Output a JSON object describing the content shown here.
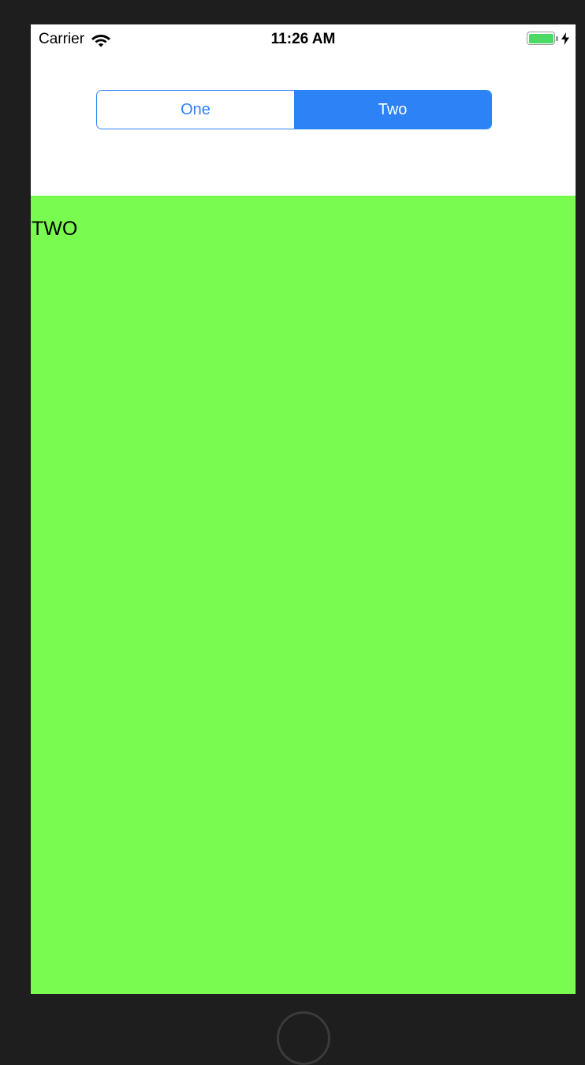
{
  "status_bar": {
    "carrier": "Carrier",
    "time": "11:26 AM",
    "wifi_icon": "wifi-icon",
    "battery_icon": "battery-icon",
    "charging_icon": "bolt-icon"
  },
  "segmented_control": {
    "segments": [
      {
        "label": "One",
        "selected": false
      },
      {
        "label": "Two",
        "selected": true
      }
    ],
    "accent_color": "#2d82f6"
  },
  "content": {
    "label": "TWO",
    "background_color": "#79fb4f"
  }
}
